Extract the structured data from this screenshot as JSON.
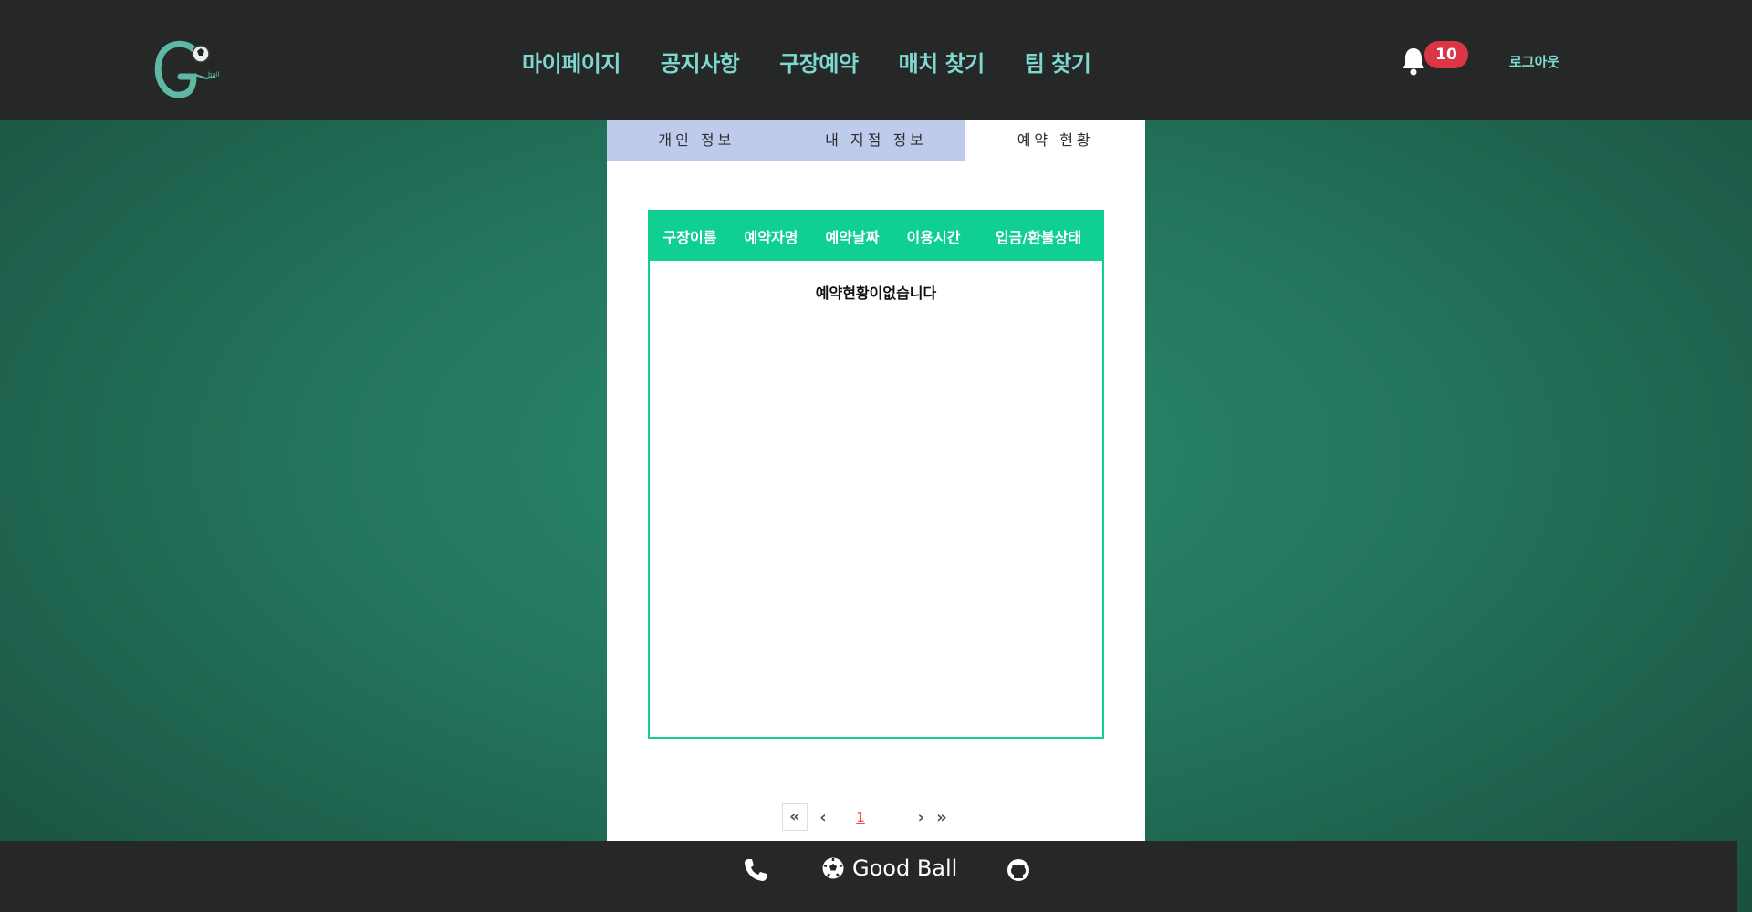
{
  "header": {
    "logo_icon": "soccer-ball-g-logo",
    "nav": [
      {
        "label": "마이페이지"
      },
      {
        "label": "공지사항"
      },
      {
        "label": "구장예약"
      },
      {
        "label": "매치 찾기"
      },
      {
        "label": "팀 찾기"
      }
    ],
    "notifications": {
      "icon": "bell-icon",
      "count": "10"
    },
    "logout_label": "로그아웃"
  },
  "tabs": [
    {
      "label": "개인 정보",
      "active": false
    },
    {
      "label": "내 지점 정보",
      "active": false
    },
    {
      "label": "예약 현황",
      "active": true
    }
  ],
  "table": {
    "headers": [
      "구장이름",
      "예약자명",
      "예약날짜",
      "이용시간",
      "입금/환불상태"
    ],
    "empty_message": "예약현황이없습니다"
  },
  "pagination": {
    "first": "«",
    "prev": "‹",
    "current_page": "1",
    "next": "›",
    "last": "»"
  },
  "footer": {
    "phone_icon": "phone-icon",
    "brand_icon": "soccer-ball-icon",
    "brand_name": "Good Ball",
    "github_icon": "github-icon"
  },
  "colors": {
    "header_bg": "#262828",
    "nav_text": "#7fd8cf",
    "badge": "#dc3545",
    "table_accent": "#0fcf92",
    "tab_inactive": "#bfcbea",
    "page_active": "#e8533c"
  }
}
